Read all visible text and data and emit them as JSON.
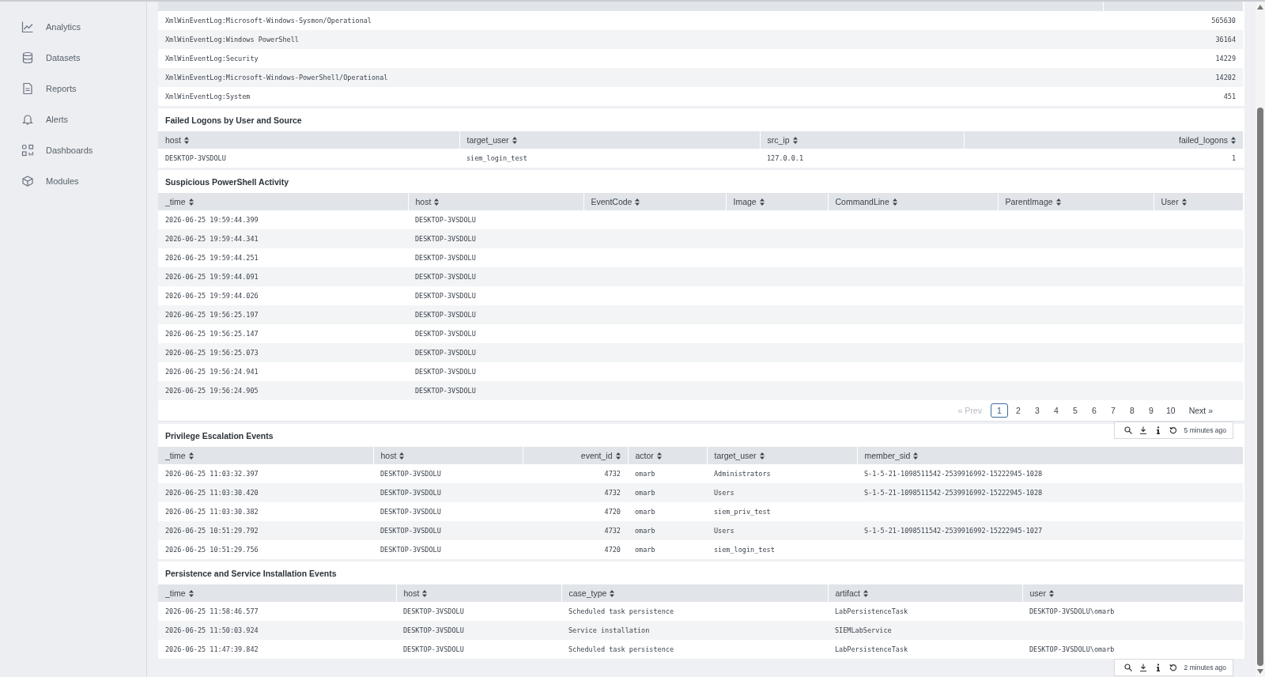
{
  "sidebar": {
    "items": [
      {
        "label": "Analytics",
        "kind": "analytics"
      },
      {
        "label": "Datasets",
        "kind": "datasets"
      },
      {
        "label": "Reports",
        "kind": "reports"
      },
      {
        "label": "Alerts",
        "kind": "alerts"
      },
      {
        "label": "Dashboards",
        "kind": "dashboards"
      },
      {
        "label": "Modules",
        "kind": "modules"
      }
    ]
  },
  "panels": [
    {
      "columns": [
        {
          "kind": "text"
        },
        {
          "kind": "number"
        }
      ],
      "rows": [
        [
          "XmlWinEventLog:Microsoft-Windows-Sysmon/Operational",
          "565630"
        ],
        [
          "XmlWinEventLog:Windows PowerShell",
          "36164"
        ],
        [
          "XmlWinEventLog:Security",
          "14229"
        ],
        [
          "XmlWinEventLog:Microsoft-Windows-PowerShell/Operational",
          "14202"
        ],
        [
          "XmlWinEventLog:System",
          "451"
        ]
      ]
    },
    {
      "title": "Failed Logons by User and Source",
      "columns": [
        {
          "label": "host",
          "kind": "text"
        },
        {
          "label": "target_user",
          "kind": "text"
        },
        {
          "label": "src_ip",
          "kind": "text"
        },
        {
          "label": "failed_logons",
          "kind": "number"
        }
      ],
      "rows": [
        [
          "DESKTOP-3VSDOLU",
          "siem_login_test",
          "127.0.0.1",
          "1"
        ]
      ]
    },
    {
      "title": "Suspicious PowerShell Activity",
      "columns": [
        {
          "label": "_time",
          "kind": "text"
        },
        {
          "label": "host",
          "kind": "text"
        },
        {
          "label": "EventCode",
          "kind": "text"
        },
        {
          "label": "Image",
          "kind": "text"
        },
        {
          "label": "CommandLine",
          "kind": "text"
        },
        {
          "label": "ParentImage",
          "kind": "text"
        },
        {
          "label": "User",
          "kind": "text"
        }
      ],
      "rows": [
        [
          "2026-06-25 19:59:44.399",
          "DESKTOP-3VSDOLU"
        ],
        [
          "2026-06-25 19:59:44.341",
          "DESKTOP-3VSDOLU"
        ],
        [
          "2026-06-25 19:59:44.251",
          "DESKTOP-3VSDOLU"
        ],
        [
          "2026-06-25 19:59:44.091",
          "DESKTOP-3VSDOLU"
        ],
        [
          "2026-06-25 19:59:44.026",
          "DESKTOP-3VSDOLU"
        ],
        [
          "2026-06-25 19:56:25.197",
          "DESKTOP-3VSDOLU"
        ],
        [
          "2026-06-25 19:56:25.147",
          "DESKTOP-3VSDOLU"
        ],
        [
          "2026-06-25 19:56:25.073",
          "DESKTOP-3VSDOLU"
        ],
        [
          "2026-06-25 19:56:24.941",
          "DESKTOP-3VSDOLU"
        ],
        [
          "2026-06-25 19:56:24.905",
          "DESKTOP-3VSDOLU"
        ]
      ],
      "pagination": {
        "prev": {
          "label": "« Prev",
          "disabled": true
        },
        "next": {
          "label": "Next »",
          "disabled": false
        },
        "pages": [
          {
            "label": "1",
            "selected": true
          },
          {
            "label": "2",
            "selected": false
          },
          {
            "label": "3",
            "selected": false
          },
          {
            "label": "4",
            "selected": false
          },
          {
            "label": "5",
            "selected": false
          },
          {
            "label": "6",
            "selected": false
          },
          {
            "label": "7",
            "selected": false
          },
          {
            "label": "8",
            "selected": false
          },
          {
            "label": "9",
            "selected": false
          },
          {
            "label": "10",
            "selected": false
          }
        ]
      },
      "footer": "5 minutes ago"
    },
    {
      "title": "Privilege Escalation Events",
      "columns": [
        {
          "label": "_time",
          "kind": "text"
        },
        {
          "label": "host",
          "kind": "text"
        },
        {
          "label": "event_id",
          "kind": "number"
        },
        {
          "label": "actor",
          "kind": "text"
        },
        {
          "label": "target_user",
          "kind": "text"
        },
        {
          "label": "member_sid",
          "kind": "text"
        }
      ],
      "rows": [
        [
          "2026-06-25 11:03:32.397",
          "DESKTOP-3VSDOLU",
          "4732",
          "omarb",
          "Administrators",
          "S-1-5-21-1098511542-2539916992-15222945-1028"
        ],
        [
          "2026-06-25 11:03:30.420",
          "DESKTOP-3VSDOLU",
          "4732",
          "omarb",
          "Users",
          "S-1-5-21-1098511542-2539916992-15222945-1028"
        ],
        [
          "2026-06-25 11:03:30.382",
          "DESKTOP-3VSDOLU",
          "4720",
          "omarb",
          "siem_priv_test"
        ],
        [
          "2026-06-25 10:51:29.792",
          "DESKTOP-3VSDOLU",
          "4732",
          "omarb",
          "Users",
          "S-1-5-21-1098511542-2539916992-15222945-1027"
        ],
        [
          "2026-06-25 10:51:29.756",
          "DESKTOP-3VSDOLU",
          "4720",
          "omarb",
          "siem_login_test"
        ]
      ]
    },
    {
      "title": "Persistence and Service Installation Events",
      "columns": [
        {
          "label": "_time",
          "kind": "text"
        },
        {
          "label": "host",
          "kind": "text"
        },
        {
          "label": "case_type",
          "kind": "text"
        },
        {
          "label": "artifact",
          "kind": "text"
        },
        {
          "label": "user",
          "kind": "text"
        }
      ],
      "rows": [
        [
          "2026-06-25 11:58:46.577",
          "DESKTOP-3VSDOLU",
          "Scheduled task persistence",
          "LabPersistenceTask",
          "DESKTOP-3VSDOLU\\omarb"
        ],
        [
          "2026-06-25 11:50:03.924",
          "DESKTOP-3VSDOLU",
          "Service installation",
          "SIEMLabService"
        ],
        [
          "2026-06-25 11:47:39.842",
          "DESKTOP-3VSDOLU",
          "Scheduled task persistence",
          "LabPersistenceTask",
          "DESKTOP-3VSDOLU\\omarb"
        ]
      ],
      "footer": "2 minutes ago"
    }
  ]
}
